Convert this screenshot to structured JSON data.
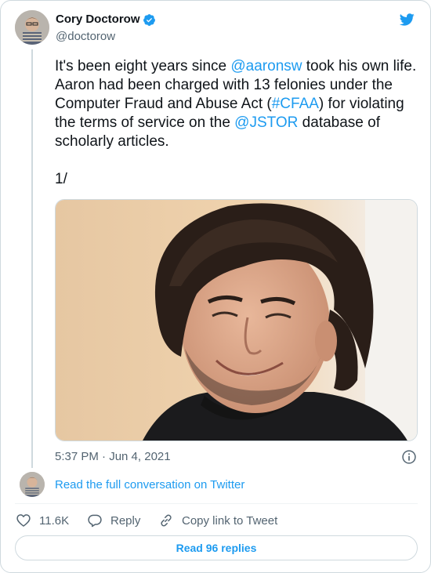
{
  "author": {
    "name": "Cory Doctorow",
    "handle": "@doctorow",
    "verified": true
  },
  "tweet": {
    "segments": [
      {
        "text": "It's been eight years since ",
        "type": "text"
      },
      {
        "text": "@aaronsw",
        "type": "link"
      },
      {
        "text": " took his own life. Aaron had been charged with 13 felonies under the Computer Fraud and Abuse Act (",
        "type": "text"
      },
      {
        "text": "#CFAA",
        "type": "link"
      },
      {
        "text": ") for violating the terms of service on the ",
        "type": "text"
      },
      {
        "text": "@JSTOR",
        "type": "link"
      },
      {
        "text": " database of scholarly articles.",
        "type": "text"
      }
    ],
    "thread_number": "1/"
  },
  "timestamp": "5:37 PM · Jun 4, 2021",
  "conversation_link": "Read the full conversation on Twitter",
  "actions": {
    "like_count": "11.6K",
    "reply_label": "Reply",
    "copy_label": "Copy link to Tweet"
  },
  "read_replies": "Read 96 replies",
  "colors": {
    "link": "#1d9bf0",
    "secondary_text": "#536471",
    "border": "#cfd9de"
  },
  "icons": [
    "verified-badge-icon",
    "twitter-bird-icon",
    "info-icon",
    "heart-icon",
    "reply-icon",
    "link-icon"
  ]
}
